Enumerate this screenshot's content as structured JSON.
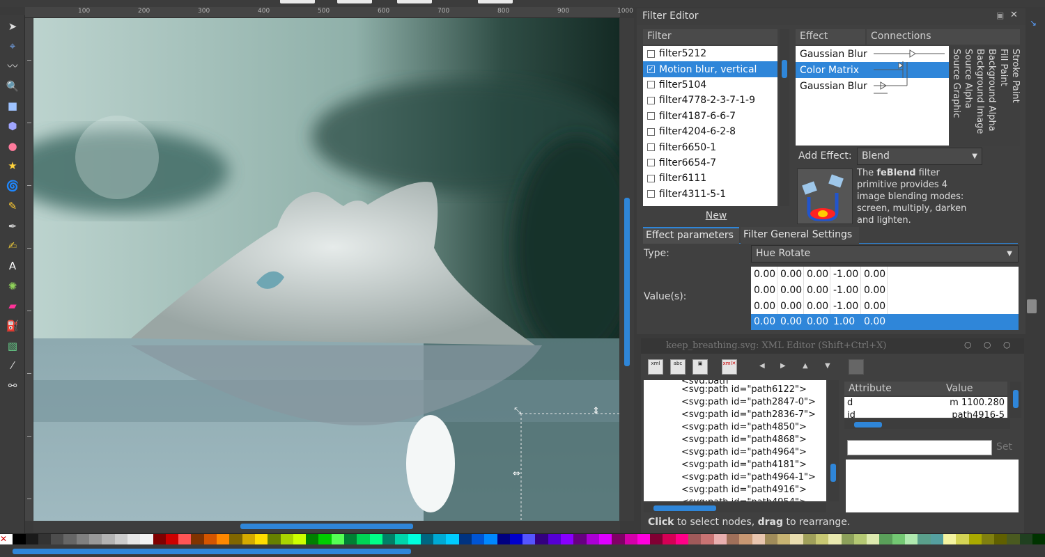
{
  "ruler": {
    "ticks": [
      "100",
      "200",
      "300",
      "400",
      "500",
      "600",
      "700",
      "800",
      "900",
      "1000"
    ]
  },
  "toolbox": {
    "tools": [
      "select-tool-icon",
      "node-tool-icon",
      "tweak-tool-icon",
      "zoom-tool-icon",
      "rectangle-tool-icon",
      "box3d-tool-icon",
      "ellipse-tool-icon",
      "star-tool-icon",
      "spiral-tool-icon",
      "pencil-tool-icon",
      "pen-tool-icon",
      "calligraphy-tool-icon",
      "text-tool-icon",
      "spray-tool-icon",
      "eraser-tool-icon",
      "paint-bucket-tool-icon",
      "gradient-tool-icon",
      "dropper-tool-icon",
      "connector-tool-icon"
    ]
  },
  "filter_editor": {
    "title": "Filter Editor",
    "filter_header": "Filter",
    "filters": [
      {
        "name": "filter5212",
        "checked": false
      },
      {
        "name": "Motion blur, vertical",
        "checked": true,
        "selected": true
      },
      {
        "name": "filter5104",
        "checked": false
      },
      {
        "name": "filter4778-2-3-7-1-9",
        "checked": false
      },
      {
        "name": "filter4187-6-6-7",
        "checked": false
      },
      {
        "name": "filter4204-6-2-8",
        "checked": false
      },
      {
        "name": "filter6650-1",
        "checked": false
      },
      {
        "name": "filter6654-7",
        "checked": false
      },
      {
        "name": "filter6111",
        "checked": false
      },
      {
        "name": "filter4311-5-1",
        "checked": false
      }
    ],
    "new_button": "New",
    "effect_header": "Effect",
    "connections_header": "Connections",
    "effects": [
      "Gaussian Blur",
      "Color Matrix",
      "Gaussian Blur"
    ],
    "selected_effect": 1,
    "inputs": [
      "Stroke Paint",
      "Fill Paint",
      "Background Alpha",
      "Background Image",
      "Source Alpha",
      "Source Graphic"
    ],
    "add_effect_label": "Add Effect:",
    "add_effect_value": "Blend",
    "desc_prefix": "The ",
    "desc_bold": "feBlend",
    "desc_line1": " filter",
    "desc_line2": "primitive provides 4",
    "desc_line3": "image blending modes:",
    "desc_line4": "screen, multiply, darken",
    "desc_line5": "and lighten.",
    "tab_params": "Effect parameters",
    "tab_general": "Filter General Settings",
    "type_label": "Type:",
    "type_value": "Hue Rotate",
    "values_label": "Value(s):",
    "matrix": [
      [
        "0.00",
        "0.00",
        "0.00",
        "-1.00",
        "0.00"
      ],
      [
        "0.00",
        "0.00",
        "0.00",
        "-1.00",
        "0.00"
      ],
      [
        "0.00",
        "0.00",
        "0.00",
        "-1.00",
        "0.00"
      ],
      [
        "0.00",
        "0.00",
        "0.00",
        "1.00",
        "0.00"
      ]
    ]
  },
  "xml_editor": {
    "title": "keep_breathing.svg: XML Editor (Shift+Ctrl+X)",
    "nodes": [
      "<svg:path id=\"path6122\">",
      "<svg:path id=\"path2847-0\">",
      "<svg:path id=\"path2836-7\">",
      "<svg:path id=\"path4850\">",
      "<svg:path id=\"path4868\">",
      "<svg:path id=\"path4964\">",
      "<svg:path id=\"path4181\">",
      "<svg:path id=\"path4964-1\">",
      "<svg:path id=\"path4916\">"
    ],
    "node_clipped_top": "<svg:path",
    "node_clipped_bottom": "<svg:path id=\"path4954\">",
    "attr_header": "Attribute",
    "value_header": "Value",
    "attrs": [
      {
        "name": "d",
        "value": "m 1100.280"
      },
      {
        "name": "id",
        "value": "path4916-5"
      }
    ],
    "set_button": "Set",
    "status_bold1": "Click",
    "status_mid": " to select nodes, ",
    "status_bold2": "drag",
    "status_end": " to rearrange."
  },
  "colors": {
    "accent": "#2f86d9",
    "panel": "#404040",
    "header": "#4a4a4a"
  }
}
